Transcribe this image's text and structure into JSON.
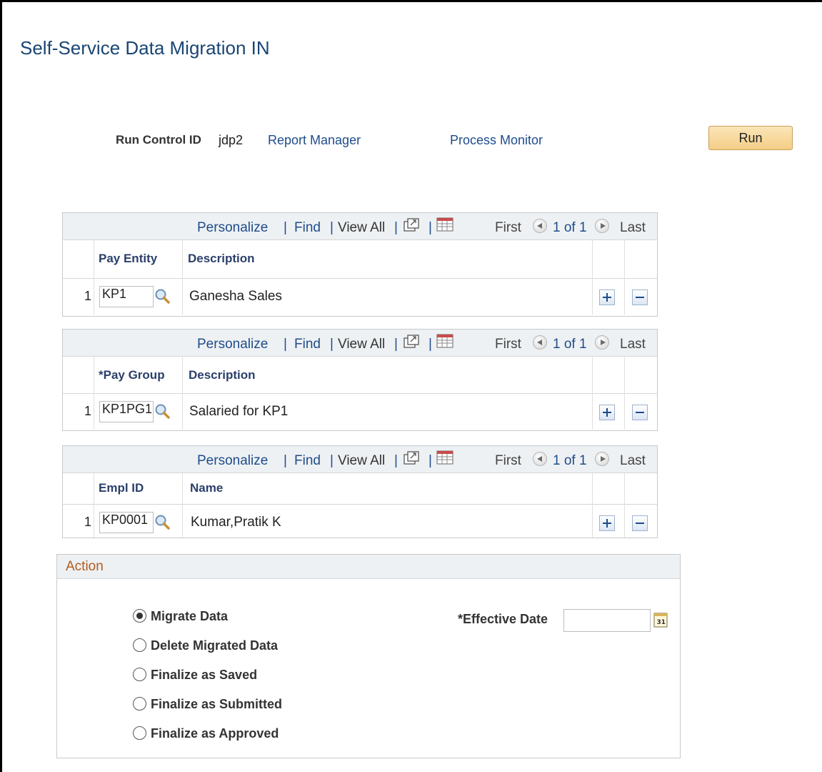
{
  "page": {
    "title": "Self-Service Data Migration IN"
  },
  "run_control": {
    "label": "Run Control ID",
    "value": "jdp2",
    "report_manager": "Report Manager",
    "process_monitor": "Process Monitor",
    "run_button": "Run"
  },
  "grid_nav": {
    "personalize": "Personalize",
    "find": "Find",
    "view_all": "View All",
    "separator": "|",
    "first": "First",
    "range": "1 of 1",
    "last": "Last"
  },
  "grids": [
    {
      "col1_header": "Pay Entity",
      "col2_header": "Description",
      "row_number": "1",
      "code": "KP1",
      "description": "Ganesha Sales"
    },
    {
      "col1_header": "*Pay Group",
      "col2_header": "Description",
      "row_number": "1",
      "code": "KP1PG1",
      "description": "Salaried for KP1"
    },
    {
      "col1_header": "Empl ID",
      "col2_header": "Name",
      "row_number": "1",
      "code": "KP0001",
      "description": "Kumar,Pratik K"
    }
  ],
  "action": {
    "title": "Action",
    "options": [
      {
        "label": "Migrate Data",
        "selected": true
      },
      {
        "label": "Delete Migrated Data",
        "selected": false
      },
      {
        "label": "Finalize as Saved",
        "selected": false
      },
      {
        "label": "Finalize as Submitted",
        "selected": false
      },
      {
        "label": "Finalize as Approved",
        "selected": false
      }
    ],
    "effective_date_label": "*Effective Date",
    "effective_date_value": "",
    "calendar_icon_text": "31"
  },
  "icons": {
    "lookup": "magnifier-icon",
    "zoom": "zoom-grid-icon",
    "download": "download-excel-icon",
    "prev": "previous-row-icon",
    "next": "next-row-icon",
    "add": "add-row-icon",
    "delete": "delete-row-icon",
    "calendar": "calendar-icon"
  },
  "colors": {
    "title": "#1a4673",
    "link": "#1f4c8c",
    "section_title": "#b25c1a",
    "run_button": "#f4ce86"
  }
}
